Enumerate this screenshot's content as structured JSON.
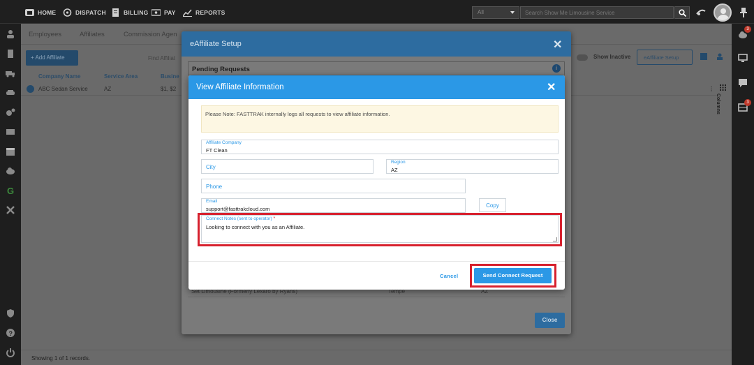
{
  "topnav": {
    "items": [
      "HOME",
      "DISPATCH",
      "BILLING",
      "PAY",
      "REPORTS"
    ],
    "search_scope": "All",
    "search_placeholder": "Search Show Me Limousine Service"
  },
  "right_rail": {
    "badge_1": "3",
    "badge_2": "3"
  },
  "page": {
    "tabs": [
      "Employees",
      "Affiliates",
      "Commission Agen"
    ],
    "add_affiliate_label": "+ Add Affiliate",
    "find_label": "Find Affiliat",
    "show_inactive_label": "Show Inactive",
    "eaffiliate_setup_label": "eAffiliate Setup",
    "columns": [
      "Company Name",
      "Service Area",
      "Busine"
    ],
    "rows": [
      {
        "company": "ABC Sedan Service",
        "area": "AZ",
        "business": "$1, $2"
      }
    ],
    "columns_label": "Columns",
    "footer": "Showing 1 of 1 records."
  },
  "setup_modal": {
    "title": "eAffiliate Setup",
    "pending_title": "Pending Requests",
    "bg_row": {
      "company": "Set Limousine (Formerly Lexaro by Ryans)",
      "city": "Tempe",
      "region": "AZ"
    },
    "close_label": "Close"
  },
  "view_modal": {
    "title": "View Affiliate Information",
    "notice": "Please Note: FASTTRAK internally logs all requests to view affiliate information.",
    "affiliate_company_label": "Affiliate Company",
    "affiliate_company_value": "FT Clean",
    "city_placeholder": "City",
    "region_label": "Region",
    "region_value": "AZ",
    "phone_placeholder": "Phone",
    "email_label": "Email",
    "email_value": "support@fasttrakcloud.com",
    "copy_label": "Copy",
    "notes_label": "Connect Notes (sent to operator)",
    "notes_required": "*",
    "notes_value": "Looking to connect with you as an Affiliate.",
    "cancel_label": "Cancel",
    "send_label": "Send Connect Request",
    "highlight_color": "#d7212e",
    "accent_color": "#2b98e6"
  }
}
